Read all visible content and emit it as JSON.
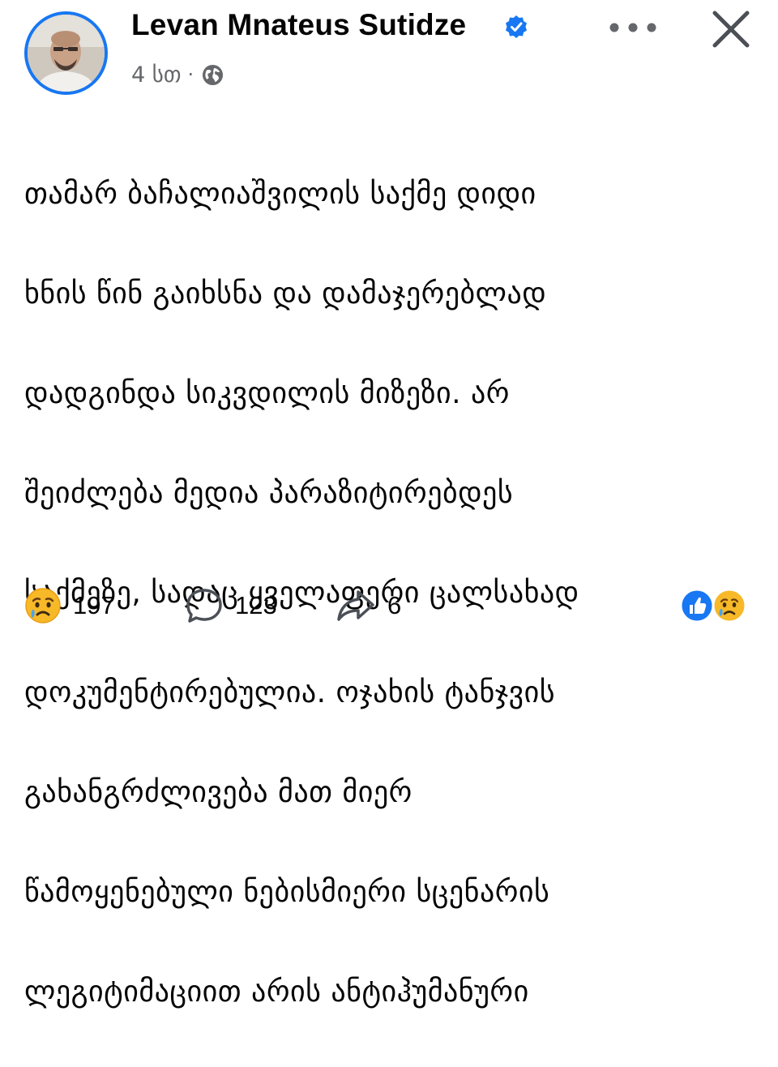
{
  "post": {
    "author": "Levan Mnateus Sutidze",
    "time": "4 სთ",
    "separator": "·",
    "verified_icon": "verified-badge-icon",
    "privacy_icon": "globe-icon",
    "text_lines": [
      "თამარ ბაჩალიაშვილის საქმე დიდი",
      "ხნის წინ გაიხსნა და დამაჯერებლად",
      "დადგინდა სიკვდილის მიზეზი. არ",
      "შეიძლება მედია პარაზიტირებდეს",
      "საქმეზე, სადაც ყველაფერი ცალსახად",
      "დოკუმენტირებულია. ოჯახის ტანჯვის",
      "გახანგრძლივება მათ მიერ",
      "წამოყენებული ნებისმიერი სცენარის",
      "ლეგიტიმაციით არის ანტიჰუმანური"
    ]
  },
  "actions": {
    "reactions_count": "197",
    "comments_count": "123",
    "shares_count": "6"
  },
  "colors": {
    "accent": "#1877f2",
    "secondary_text": "#65676b",
    "primary_text": "#050505"
  }
}
